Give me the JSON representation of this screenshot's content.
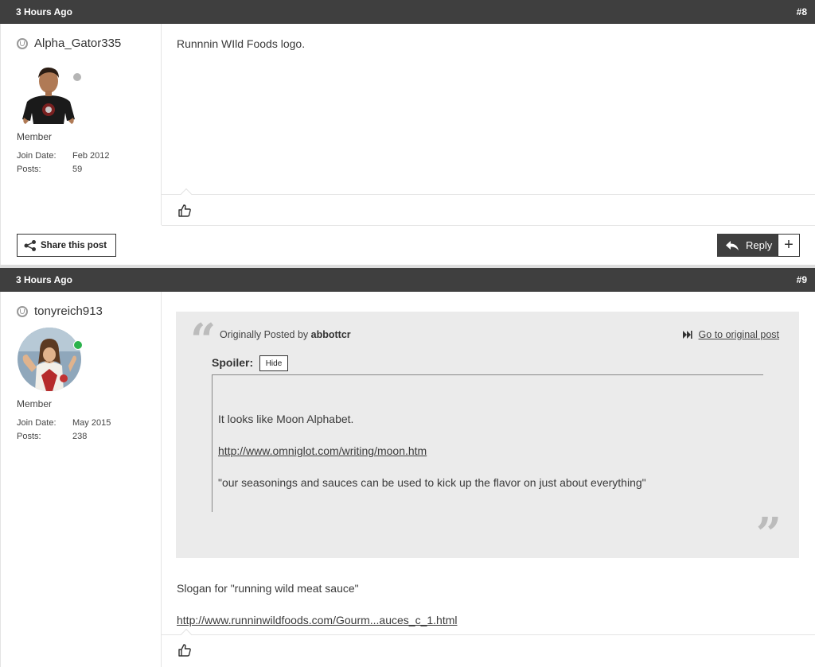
{
  "posts": [
    {
      "time": "3 Hours Ago",
      "number": "#8",
      "username": "Alpha_Gator335",
      "role": "Member",
      "join_date_label": "Join Date:",
      "join_date": "Feb 2012",
      "posts_label": "Posts:",
      "posts": "59",
      "online": false,
      "body": "Runnnin WIld Foods logo."
    },
    {
      "time": "3 Hours Ago",
      "number": "#9",
      "username": "tonyreich913",
      "role": "Member",
      "join_date_label": "Join Date:",
      "join_date": "May 2015",
      "posts_label": "Posts:",
      "posts": "238",
      "online": true,
      "quote": {
        "originally_posted_by": "Originally Posted by",
        "author": "abbottcr",
        "go_to_original": "Go to original post",
        "spoiler_label": "Spoiler:",
        "hide_label": "Hide",
        "lines": [
          "It looks like Moon Alphabet.",
          "http://www.omniglot.com/writing/moon.htm",
          "\"our seasonings and sauces can be used to kick up the flavor on just about everything\""
        ]
      },
      "body_lines": [
        "Slogan for \"running wild meat sauce\"",
        "http://www.runninwildfoods.com/Gourm...auces_c_1.html"
      ]
    }
  ],
  "actions": {
    "share_label": "Share this post",
    "reply_label": "Reply",
    "plus_label": "+"
  },
  "colors": {
    "header_bg": "#3f3f3f",
    "online": "#2bb24c",
    "offline": "#b5b5b5",
    "quote_bg": "#ebebeb"
  }
}
